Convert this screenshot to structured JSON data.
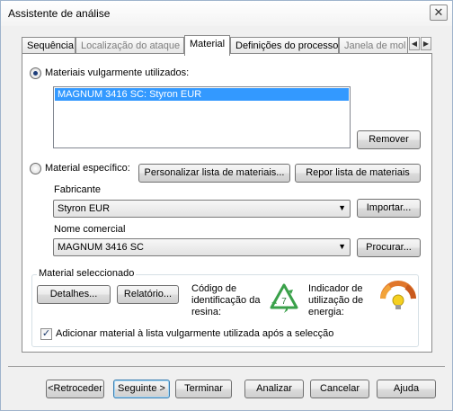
{
  "window": {
    "title": "Assistente de análise",
    "close_glyph": "✕"
  },
  "tabs": [
    {
      "label": "Sequência",
      "state": "normal"
    },
    {
      "label": "Localização do ataque",
      "state": "disabled"
    },
    {
      "label": "Material",
      "state": "active"
    },
    {
      "label": "Definições do processo",
      "state": "normal"
    },
    {
      "label": "Janela de mol",
      "state": "disabled"
    }
  ],
  "tab_scroll": {
    "left_icon": "◀",
    "right_icon": "▶"
  },
  "common": {
    "radio_label": "Materiais vulgarmente utilizados:",
    "selected_item": "MAGNUM 3416 SC: Styron EUR",
    "remove_label": "Remover"
  },
  "specific": {
    "radio_label": "Material específico:",
    "customize_label": "Personalizar lista de materiais...",
    "reset_label": "Repor lista de materiais",
    "manufacturer_label": "Fabricante",
    "manufacturer_value": "Styron EUR",
    "import_label": "Importar...",
    "trade_name_label": "Nome comercial",
    "trade_name_value": "MAGNUM 3416 SC",
    "search_label": "Procurar..."
  },
  "selected_material": {
    "group_title": "Material seleccionado",
    "details_label": "Detalhes...",
    "report_label": "Relatório...",
    "resin_code_label_1": "Código de",
    "resin_code_label_2": "identificação da",
    "resin_code_label_3": "resina:",
    "resin_code_number": "7",
    "energy_label_1": "Indicador de",
    "energy_label_2": "utilização de",
    "energy_label_3": "energia:",
    "add_checkbox_label": "Adicionar material à lista vulgarmente utilizada após a selecção",
    "add_checked": true
  },
  "footer": {
    "back_label": "<Retroceder",
    "next_label": "Seguinte >",
    "finish_label": "Terminar",
    "analyze_label": "Analizar",
    "cancel_label": "Cancelar",
    "help_label": "Ajuda"
  },
  "colors": {
    "selection": "#3399ff",
    "recycle_green": "#3aa14a",
    "gauge_orange": "#e0762b",
    "bulb_yellow": "#f5d020"
  }
}
